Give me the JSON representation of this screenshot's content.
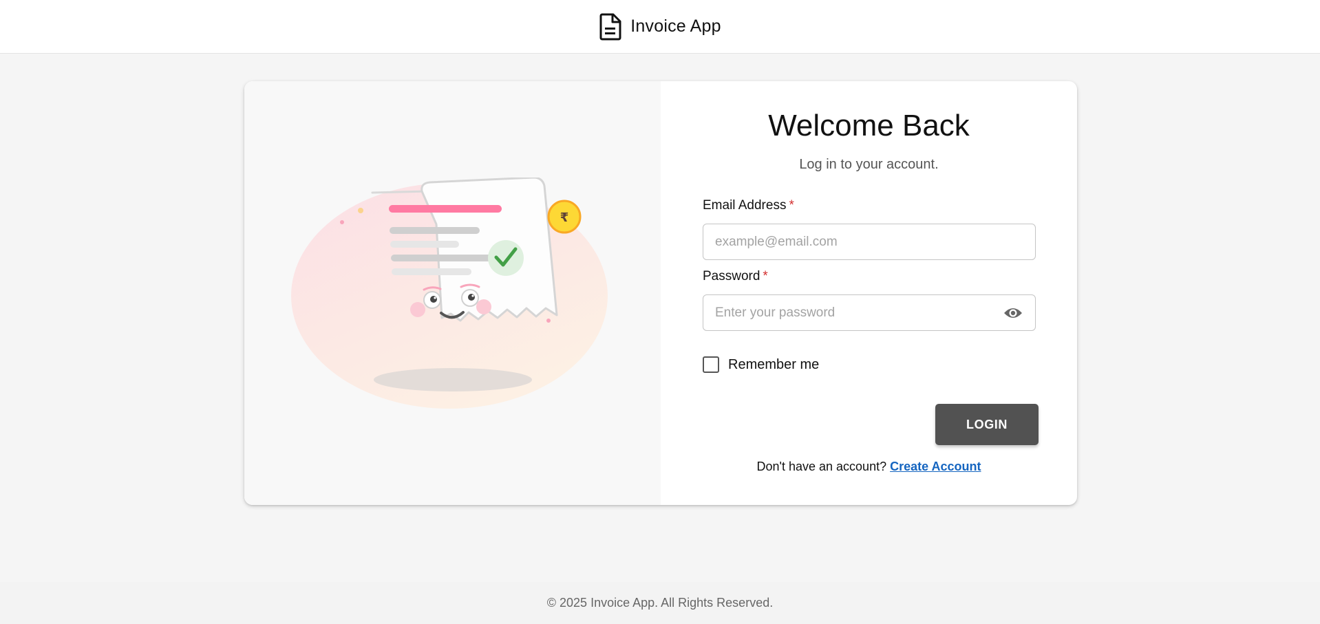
{
  "header": {
    "app_title": "Invoice App",
    "logo_icon": "document-icon"
  },
  "login": {
    "title": "Welcome Back",
    "subtitle": "Log in to your account.",
    "email": {
      "label": "Email Address",
      "required_mark": "*",
      "placeholder": "example@email.com",
      "value": ""
    },
    "password": {
      "label": "Password",
      "required_mark": "*",
      "placeholder": "Enter your password",
      "value": "",
      "toggle_icon": "eye-icon"
    },
    "remember_me": {
      "label": "Remember me",
      "checked": false
    },
    "login_button": "LOGIN",
    "signup_prompt": "Don't have an account?",
    "signup_link": "Create Account"
  },
  "illustration": {
    "coin_symbol": "₹"
  },
  "footer": {
    "copyright": "© 2025 Invoice App. All Rights Reserved."
  },
  "colors": {
    "button_bg": "#525252",
    "link": "#1565c0",
    "required": "#d32f2f",
    "accent_pink": "#ff7aa2",
    "coin": "#fbc02d",
    "check": "#43a047"
  }
}
